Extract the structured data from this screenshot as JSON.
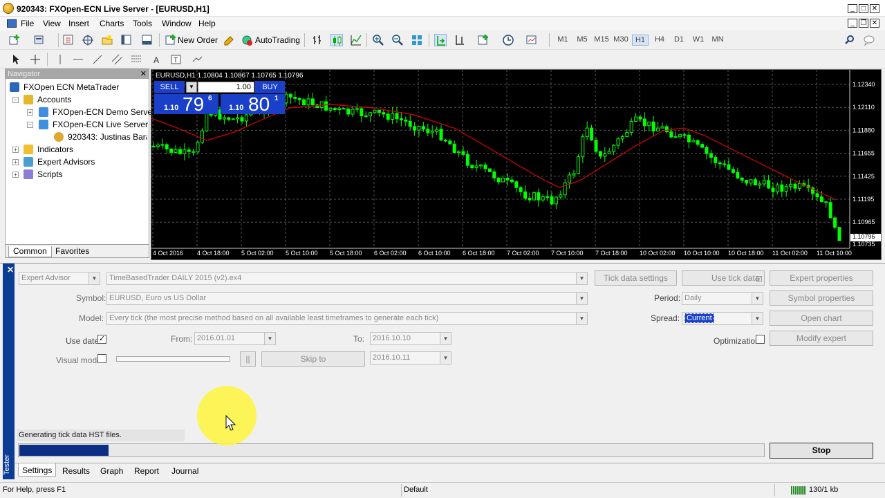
{
  "window": {
    "title": "920343: FXOpen-ECN Live Server - [EURUSD,H1]"
  },
  "menu": [
    "File",
    "View",
    "Insert",
    "Charts",
    "Tools",
    "Window",
    "Help"
  ],
  "toolbar": {
    "new_order": "New Order",
    "autotrading": "AutoTrading",
    "timeframes": [
      "M1",
      "M5",
      "M15",
      "M30",
      "H1",
      "H4",
      "D1",
      "W1",
      "MN"
    ],
    "active_timeframe": "H1"
  },
  "navigator": {
    "title": "Navigator",
    "root": "FXOpen ECN MetaTrader",
    "accounts": "Accounts",
    "demo_server": "FXOpen-ECN Demo Server",
    "live_server": "FXOpen-ECN Live Server",
    "account": "920343: Justinas Baraus",
    "indicators": "Indicators",
    "experts": "Expert Advisors",
    "scripts": "Scripts",
    "tabs": [
      "Common",
      "Favorites"
    ]
  },
  "chart": {
    "header": "EURUSD,H1  1.10804 1.10867 1.10765 1.10796",
    "sell": "SELL",
    "buy": "BUY",
    "lots": "1.00",
    "sell_big": "1.10",
    "sell_pips": "79",
    "sell_frac": "6",
    "buy_big": "1.10",
    "buy_pips": "80",
    "buy_frac": "1",
    "price_labels": [
      "1.12340",
      "1.12110",
      "1.11880",
      "1.11655",
      "1.11425",
      "1.11195",
      "1.10965",
      "1.10796",
      "1.10735"
    ],
    "current_price": "1.10796",
    "time_labels": [
      "4 Oct 2016",
      "4 Oct 18:00",
      "5 Oct 02:00",
      "5 Oct 10:00",
      "5 Oct 18:00",
      "6 Oct 02:00",
      "6 Oct 10:00",
      "6 Oct 18:00",
      "7 Oct 02:00",
      "7 Oct 10:00",
      "7 Oct 18:00",
      "10 Oct 02:00",
      "10 Oct 10:00",
      "10 Oct 18:00",
      "11 Oct 02:00",
      "11 Oct 10:00"
    ],
    "colors": {
      "bull": "#00ff00",
      "bear": "#00ff00",
      "ma": "#e00000",
      "grid": "#555"
    }
  },
  "tester": {
    "side_label": "Tester",
    "type": "Expert Advisor",
    "expert": "TimeBasedTrader DAILY 2015 (v2).ex4",
    "tick_settings": "Tick data settings",
    "use_tick_data": "Use tick data",
    "expert_props": "Expert properties",
    "symbol_label": "Symbol:",
    "symbol": "EURUSD, Euro vs US Dollar",
    "period_label": "Period:",
    "period": "Daily",
    "symbol_props": "Symbol properties",
    "model_label": "Model:",
    "model": "Every tick (the most precise method based on all available least timeframes to generate each tick)",
    "spread_label": "Spread:",
    "spread": "Current",
    "open_chart": "Open chart",
    "use_date": "Use date",
    "from_label": "From:",
    "from": "2016.01.01",
    "to_label": "To:",
    "to": "2016.10.10",
    "optimization": "Optimization",
    "modify_expert": "Modify expert",
    "visual_mode": "Visual mode",
    "skip_to": "Skip to",
    "skip_date": "2016.10.11",
    "pause": "||",
    "status": "Generating tick data HST files.",
    "progress": 0.12,
    "stop": "Stop",
    "tabs": [
      "Settings",
      "Results",
      "Graph",
      "Report",
      "Journal"
    ]
  },
  "statusbar": {
    "help": "For Help, press F1",
    "profile": "Default",
    "traffic": "130/1 kb"
  }
}
